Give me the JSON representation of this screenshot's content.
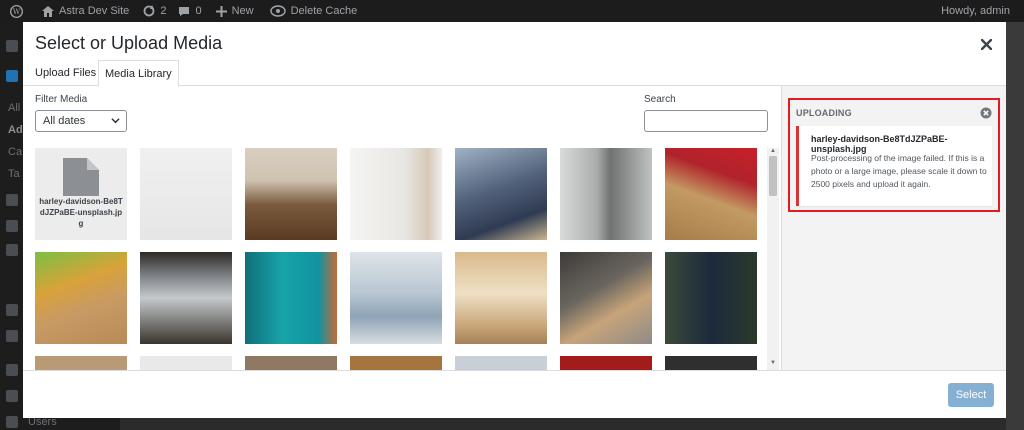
{
  "adminbar": {
    "site_name": "Astra Dev Site",
    "updates_count": "2",
    "comments_count": "0",
    "new_label": "New",
    "delete_cache_label": "Delete Cache",
    "howdy": "Howdy, admin"
  },
  "admin_sidebar": {
    "items": [
      "All",
      "Ad",
      "Ca",
      "Ta",
      "Users"
    ]
  },
  "modal": {
    "title": "Select or Upload Media",
    "tabs": [
      {
        "label": "Upload Files",
        "active": false
      },
      {
        "label": "Media Library",
        "active": true
      }
    ],
    "filter": {
      "label": "Filter Media",
      "selected": "All dates"
    },
    "search": {
      "label": "Search",
      "value": ""
    },
    "grid": {
      "file_thumb_name": "harley-davidson-Be8TdJZPaBE-unsplash.jpg"
    },
    "uploading": {
      "heading": "UPLOADING",
      "filename": "harley-davidson-Be8TdJZPaBE-unsplash.jpg",
      "message": "Post-processing of the image failed. If this is a photo or a large image, please scale it down to 2500 pixels and upload it again.",
      "error_color": "#d63638",
      "highlight_color": "#e01b22"
    },
    "footer": {
      "select_label": "Select"
    },
    "accent_color": "#2271b1"
  }
}
